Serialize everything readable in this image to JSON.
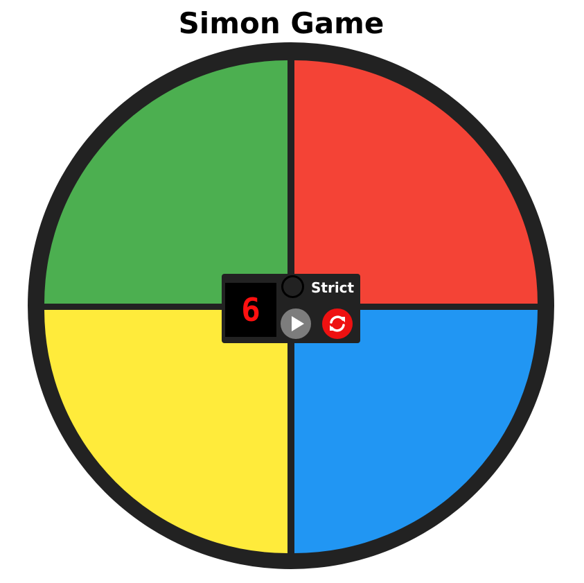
{
  "title": "Simon Game",
  "board": {
    "quadrants": [
      {
        "name": "green",
        "color": "#4caf50"
      },
      {
        "name": "red",
        "color": "#f44336"
      },
      {
        "name": "yellow",
        "color": "#ffeb3b"
      },
      {
        "name": "blue",
        "color": "#2196f3"
      }
    ],
    "ring_color": "#222222"
  },
  "controls": {
    "count": "6",
    "strict_label": "Strict",
    "start_icon": "play-icon",
    "reset_icon": "refresh-icon",
    "start_color": "#7d7d7d",
    "reset_color": "#ee1111"
  }
}
